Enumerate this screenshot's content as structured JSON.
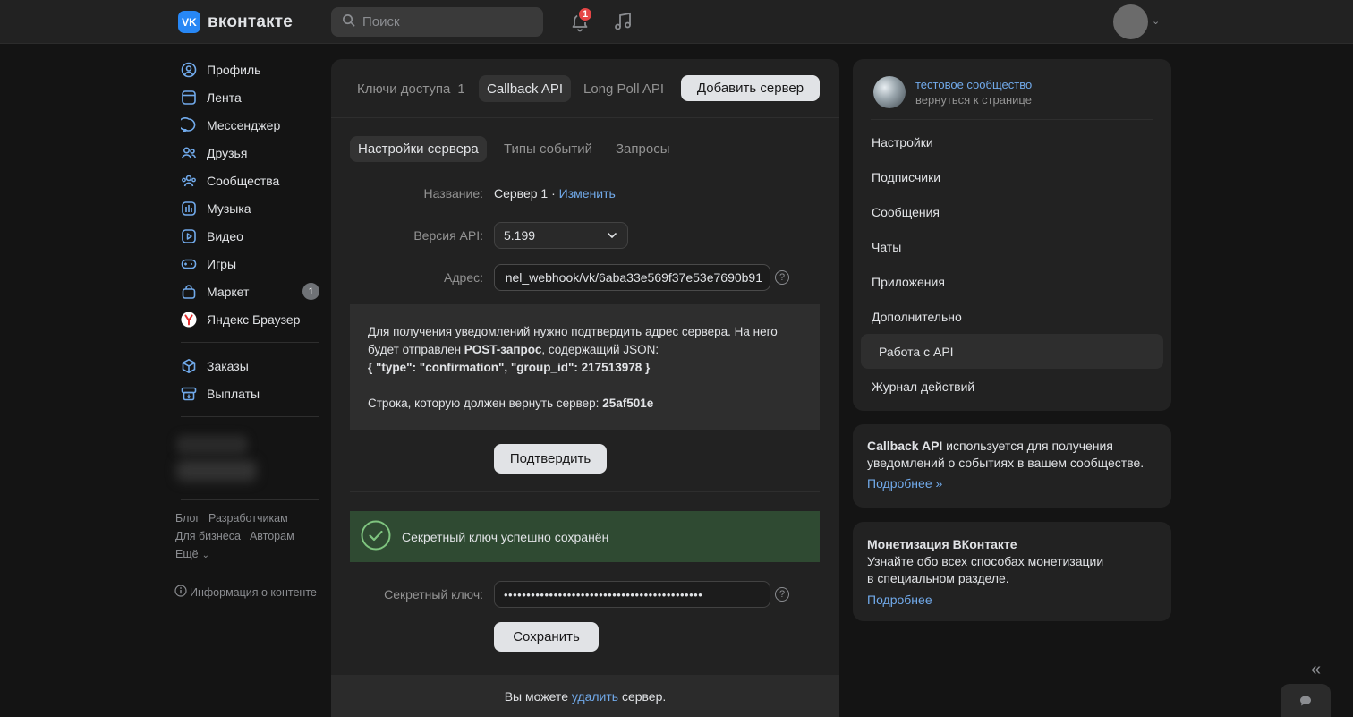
{
  "header": {
    "logo_badge": "VK",
    "logo_text": "вконтакте",
    "search_placeholder": "Поиск",
    "notification_count": "1"
  },
  "leftnav": {
    "items": [
      {
        "label": "Профиль",
        "icon": "user-icon"
      },
      {
        "label": "Лента",
        "icon": "feed-icon"
      },
      {
        "label": "Мессенджер",
        "icon": "message-icon"
      },
      {
        "label": "Друзья",
        "icon": "friends-icon"
      },
      {
        "label": "Сообщества",
        "icon": "groups-icon"
      },
      {
        "label": "Музыка",
        "icon": "music-icon"
      },
      {
        "label": "Видео",
        "icon": "video-icon"
      },
      {
        "label": "Игры",
        "icon": "gamepad-icon"
      },
      {
        "label": "Маркет",
        "icon": "bag-icon",
        "count": "1"
      },
      {
        "label": "Яндекс Браузер",
        "icon": "yandex-browser-icon"
      }
    ],
    "items2": [
      {
        "label": "Заказы",
        "icon": "box-icon"
      },
      {
        "label": "Выплаты",
        "icon": "payout-icon"
      }
    ],
    "footer": {
      "blog": "Блог",
      "developers": "Разработчикам",
      "business": "Для бизнеса",
      "authors": "Авторам",
      "more": "Ещё"
    },
    "info": "Информация о контенте"
  },
  "main": {
    "tabs": {
      "keys": "Ключи доступа",
      "keys_count": "1",
      "callback": "Callback API",
      "longpoll": "Long Poll API",
      "add_server": "Добавить сервер"
    },
    "subtabs": {
      "settings": "Настройки сервера",
      "events": "Типы событий",
      "requests": "Запросы"
    },
    "name_label": "Название:",
    "name_value": "Сервер 1",
    "name_sep": " · ",
    "name_edit": "Изменить",
    "api_label": "Версия API:",
    "api_value": "5.199",
    "address_label": "Адрес:",
    "address_value": "nel_webhook/vk/6aba33e569f37e53e7690b91",
    "notice": {
      "line1": "Для получения уведомлений нужно подтвердить адрес сервера. На него",
      "line2_prefix": "будет отправлен ",
      "line2_bold": "POST-запрос",
      "line2_suffix": ", содержащий JSON:",
      "json": "{ \"type\": \"confirmation\", \"group_id\": 217513978 }",
      "return_prefix": "Строка, которую должен вернуть сервер: ",
      "return_value": "25af501e"
    },
    "confirm_button": "Подтвердить",
    "success_text": "Секретный ключ успешно сохранён",
    "secret_label": "Секретный ключ:",
    "secret_value": "••••••••••••••••••••••••••••••••••••••••••••",
    "save_button": "Сохранить",
    "footer_prefix": "Вы можете ",
    "footer_link": "удалить",
    "footer_suffix": " сервер."
  },
  "right": {
    "group_name": "тестовое сообщество",
    "group_back": "вернуться к странице",
    "menu": [
      {
        "label": "Настройки",
        "active": false
      },
      {
        "label": "Подписчики",
        "active": false
      },
      {
        "label": "Сообщения",
        "active": false
      },
      {
        "label": "Чаты",
        "active": false
      },
      {
        "label": "Приложения",
        "active": false
      },
      {
        "label": "Дополнительно",
        "active": false
      },
      {
        "label": "Работа с API",
        "active": true
      },
      {
        "label": "Журнал действий",
        "active": false
      }
    ],
    "card1": {
      "bold": "Callback API",
      "text": " используется для получения уведомлений о событиях в вашем сообществе.",
      "link": "Подробнее »"
    },
    "card2": {
      "title": "Монетизация ВКонтакте",
      "line1": "Узнайте обо всех способах монетизации",
      "line2": "в специальном разделе.",
      "link": "Подробнее"
    }
  },
  "colors": {
    "accent_link": "#71aaeb",
    "brand": "#2787f5",
    "success_bg": "#2f4a32",
    "badge_red": "#e64646"
  }
}
